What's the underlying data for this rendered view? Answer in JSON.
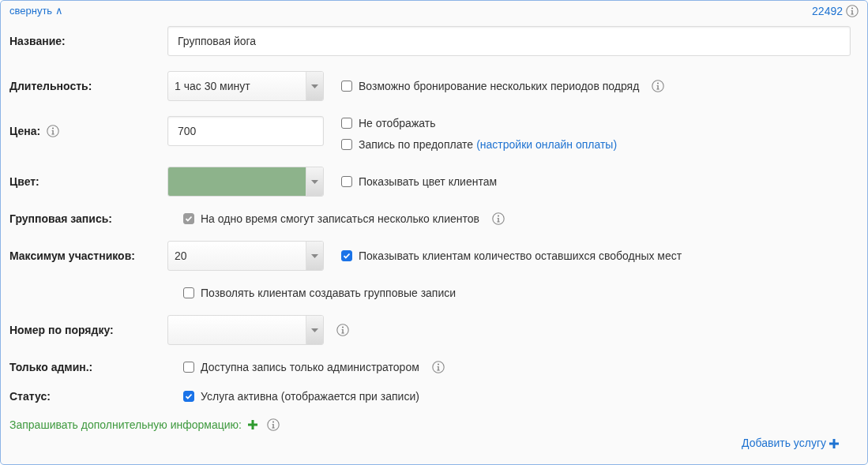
{
  "header": {
    "collapse_link": "свернуть ∧",
    "record_id": "22492"
  },
  "rows": [
    {
      "label": "Название:",
      "control": {
        "kind": "text",
        "value": "Групповая йога"
      }
    },
    {
      "label": "Длительность:",
      "control": {
        "kind": "select",
        "value": "1 час 30 минут"
      },
      "options": [
        {
          "checked": false,
          "text": "Возможно бронирование нескольких периодов подряд",
          "info": true
        }
      ]
    },
    {
      "label": "Цена:",
      "label_info": true,
      "control": {
        "kind": "text",
        "value": "700"
      },
      "options": [
        {
          "checked": false,
          "text": "Не отображать"
        },
        {
          "checked": false,
          "text": "Запись по предоплате",
          "link": "(настройки онлайн оплаты)"
        }
      ]
    },
    {
      "label": "Цвет:",
      "control": {
        "kind": "color",
        "color": "#8db38b"
      },
      "options": [
        {
          "checked": false,
          "text": "Показывать цвет клиентам"
        }
      ]
    },
    {
      "label": "Групповая запись:",
      "control": {
        "kind": "checkbox",
        "checked": true,
        "disabled": true,
        "text": "На одно время смогут записаться несколько клиентов",
        "info": true
      }
    },
    {
      "label": "Максимум участников:",
      "control": {
        "kind": "select",
        "value": "20"
      },
      "options": [
        {
          "checked": true,
          "text": "Показывать клиентам количество оставшихся свободных мест"
        }
      ]
    },
    {
      "control": {
        "kind": "checkbox",
        "checked": false,
        "text": "Позволять клиентам создавать групповые записи"
      }
    },
    {
      "label": "Номер по порядку:",
      "control": {
        "kind": "select",
        "info": true
      }
    },
    {
      "label": "Только админ.:",
      "control": {
        "kind": "checkbox",
        "checked": false,
        "text": "Доступна запись только администратором",
        "info": true
      }
    },
    {
      "label": "Статус:",
      "control": {
        "kind": "checkbox",
        "checked": true,
        "text": "Услуга активна (отображается при записи)"
      }
    }
  ],
  "extra_info": {
    "text": "Запрашивать дополнительную информацию:"
  },
  "add_service": {
    "text": "Добавить услугу"
  }
}
